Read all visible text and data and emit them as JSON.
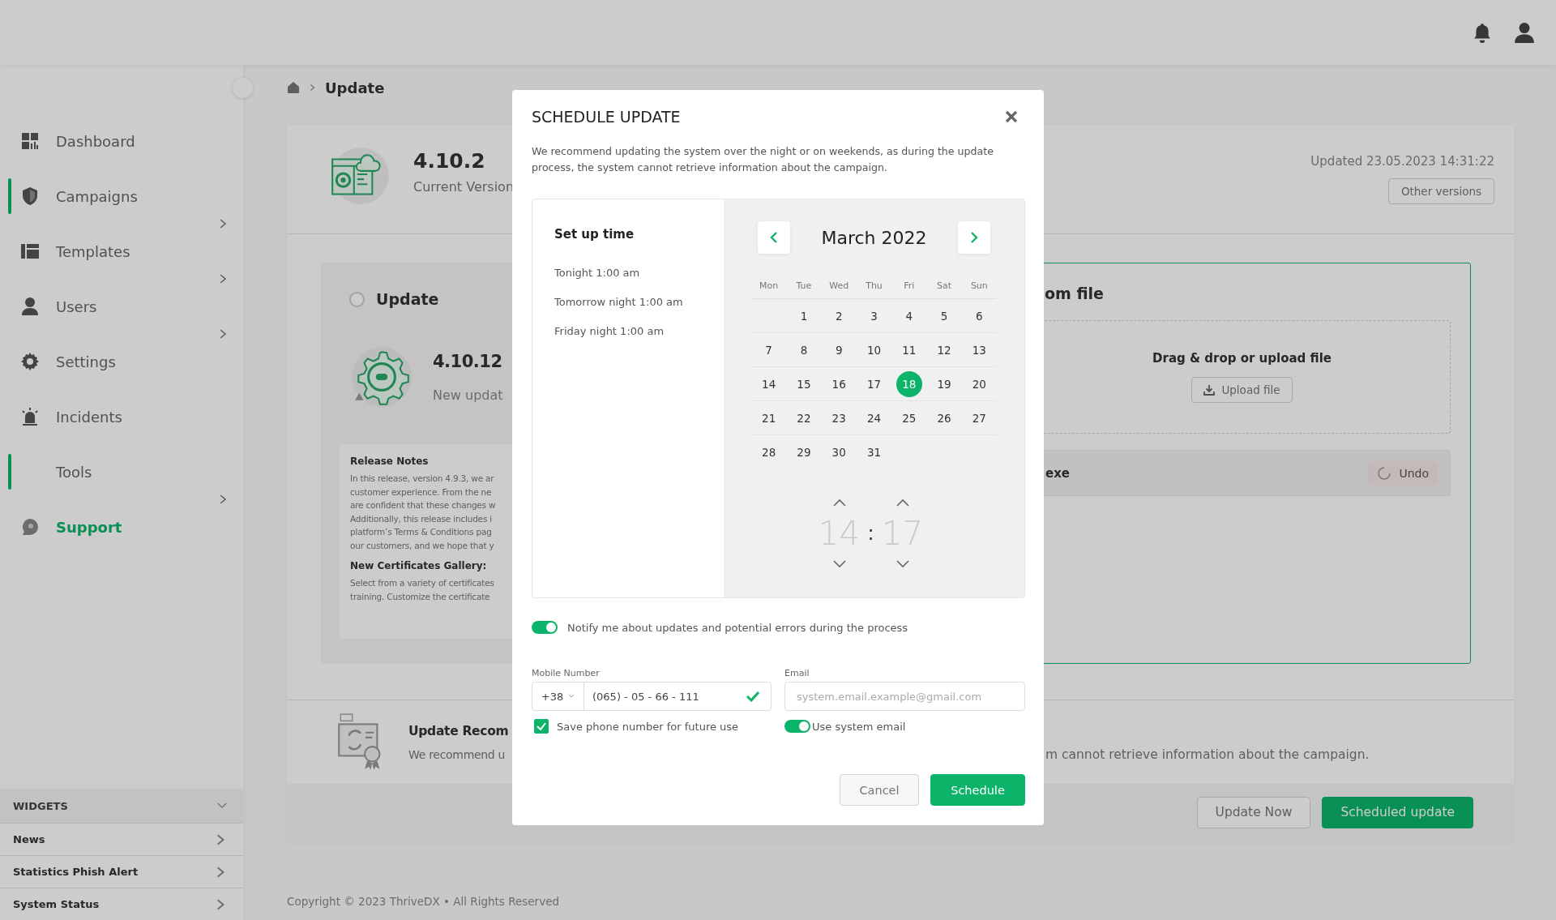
{
  "sidebar": {
    "items": [
      {
        "label": "Dashboard",
        "accent": false,
        "expandable": false,
        "selected": false
      },
      {
        "label": "Campaigns",
        "accent": true,
        "expandable": true,
        "selected": false
      },
      {
        "label": "Templates",
        "accent": false,
        "expandable": true,
        "selected": false
      },
      {
        "label": "Users",
        "accent": false,
        "expandable": true,
        "selected": false
      },
      {
        "label": "Settings",
        "accent": false,
        "expandable": false,
        "selected": false
      },
      {
        "label": "Incidents",
        "accent": false,
        "expandable": false,
        "selected": false
      },
      {
        "label": "Tools",
        "accent": true,
        "expandable": true,
        "selected": false
      },
      {
        "label": "Support",
        "accent": false,
        "expandable": false,
        "selected": true
      }
    ],
    "widgets": {
      "title": "WIDGETS",
      "expanded": true,
      "items": [
        "News",
        "Statistics Phish Alert",
        "System Status"
      ]
    }
  },
  "breadcrumb": {
    "current": "Update"
  },
  "current_version": {
    "version": "4.10.2",
    "label": "Current Version",
    "updated": "Updated 23.05.2023  14:31:22",
    "button": "Other versions"
  },
  "update_option": {
    "title": "Update",
    "selected": false,
    "version": "4.10.12",
    "subtitle": "New updat",
    "release_notes": {
      "heading": "Release Notes",
      "lines": [
        "In this release, version 4.9.3, we ar",
        "customer experience. From the ne",
        "are confident that these changes w",
        "Additionally, this release includes i",
        "platform’s Terms & Conditions pag",
        "our customers, and we hope that y"
      ],
      "subheading": "New Certificates Gallery:",
      "sublines": [
        "Select from a variety of certificates",
        "training. Customize the certificate"
      ]
    }
  },
  "file_option": {
    "title": "om file",
    "selected": true,
    "drop_text": "Drag & drop or upload file",
    "upload_button": "Upload file",
    "file_name": "exe",
    "undo_button": "Undo"
  },
  "recommendation": {
    "title": "Update Recom",
    "text_left": "We recommend u",
    "text_right": "m cannot retrieve information about the campaign."
  },
  "actions": [
    {
      "label": "Update Now",
      "kind": "secondary"
    },
    {
      "label": "Scheduled update",
      "kind": "primary"
    }
  ],
  "footer": {
    "copyright": "Copyright © 2023 ThriveDX • All Rights Reserved"
  },
  "modal": {
    "title": "SCHEDULE UPDATE",
    "description": "We recommend updating the system over the night or on weekends, as during the update process, the system cannot retrieve information about the campaign.",
    "presets": {
      "title": "Set up time",
      "items": [
        "Tonight 1:00 am",
        "Tomorrow night 1:00 am",
        "Friday night 1:00 am"
      ]
    },
    "calendar": {
      "month": "March 2022",
      "weekdays": [
        "Mon",
        "Tue",
        "Wed",
        "Thu",
        "Fri",
        "Sat",
        "Sun"
      ],
      "weeks": [
        [
          {
            "kind": "empty"
          },
          {
            "kind": "day",
            "label": "1",
            "selected": false
          },
          {
            "kind": "day",
            "label": "2",
            "selected": false
          },
          {
            "kind": "day",
            "label": "3",
            "selected": false
          },
          {
            "kind": "day",
            "label": "4",
            "selected": false
          },
          {
            "kind": "day",
            "label": "5",
            "selected": false
          },
          {
            "kind": "day",
            "label": "6",
            "selected": false
          }
        ],
        [
          {
            "kind": "day",
            "label": "7",
            "selected": false
          },
          {
            "kind": "day",
            "label": "8",
            "selected": false
          },
          {
            "kind": "day",
            "label": "9",
            "selected": false
          },
          {
            "kind": "day",
            "label": "10",
            "selected": false
          },
          {
            "kind": "day",
            "label": "11",
            "selected": false
          },
          {
            "kind": "day",
            "label": "12",
            "selected": false
          },
          {
            "kind": "day",
            "label": "13",
            "selected": false
          }
        ],
        [
          {
            "kind": "day",
            "label": "14",
            "selected": false
          },
          {
            "kind": "day",
            "label": "15",
            "selected": false
          },
          {
            "kind": "day",
            "label": "16",
            "selected": false
          },
          {
            "kind": "day",
            "label": "17",
            "selected": false
          },
          {
            "kind": "day",
            "label": "18",
            "selected": true
          },
          {
            "kind": "day",
            "label": "19",
            "selected": false
          },
          {
            "kind": "day",
            "label": "20",
            "selected": false
          }
        ],
        [
          {
            "kind": "day",
            "label": "21",
            "selected": false
          },
          {
            "kind": "day",
            "label": "22",
            "selected": false
          },
          {
            "kind": "day",
            "label": "23",
            "selected": false
          },
          {
            "kind": "day",
            "label": "24",
            "selected": false
          },
          {
            "kind": "day",
            "label": "25",
            "selected": false
          },
          {
            "kind": "day",
            "label": "26",
            "selected": false
          },
          {
            "kind": "day",
            "label": "27",
            "selected": false
          }
        ],
        [
          {
            "kind": "day",
            "label": "28",
            "selected": false
          },
          {
            "kind": "day",
            "label": "29",
            "selected": false
          },
          {
            "kind": "day",
            "label": "30",
            "selected": false
          },
          {
            "kind": "day",
            "label": "31",
            "selected": false
          }
        ]
      ]
    },
    "time": {
      "hours": "14",
      "separator": ":",
      "minutes": "17"
    },
    "notify": {
      "on": true,
      "label": "Notify me about updates and potential errors during the process"
    },
    "phone": {
      "label": "Mobile Number",
      "country_code": "+38",
      "value": "(065) - 05 - 66 - 111",
      "valid": true
    },
    "email": {
      "label": "Email",
      "placeholder": "system.email.example@gmail.com"
    },
    "save_phone": {
      "checked": true,
      "label": "Save phone number for future use"
    },
    "use_system_email": {
      "on": true,
      "label": "Use system email"
    },
    "buttons": [
      {
        "label": "Cancel",
        "kind": "secondary"
      },
      {
        "label": "Schedule",
        "kind": "primary"
      }
    ]
  }
}
